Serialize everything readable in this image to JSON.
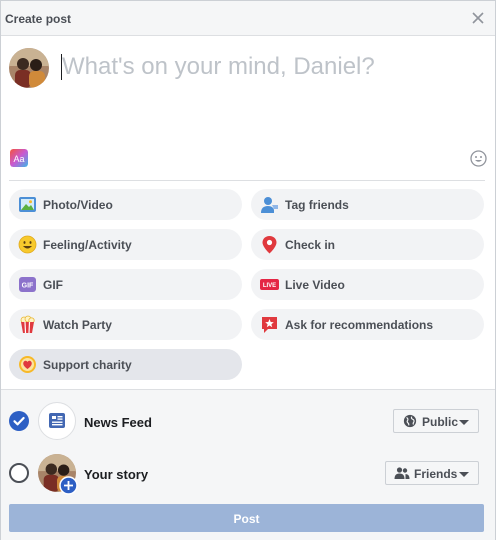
{
  "header": {
    "title": "Create post"
  },
  "composer": {
    "placeholder": "What's on your mind, Daniel?"
  },
  "actions": {
    "photo_video": "Photo/Video",
    "tag_friends": "Tag friends",
    "feeling_activity": "Feeling/Activity",
    "check_in": "Check in",
    "gif": "GIF",
    "live_video": "Live Video",
    "watch_party": "Watch Party",
    "ask_recommendations": "Ask for recommendations",
    "support_charity": "Support charity"
  },
  "icon_text": {
    "gif": "GIF",
    "live": "LIVE"
  },
  "destinations": {
    "news_feed": {
      "label": "News Feed",
      "checked": true,
      "privacy": "Public"
    },
    "your_story": {
      "label": "Your story",
      "checked": false,
      "privacy": "Friends"
    }
  },
  "post_button": {
    "label": "Post"
  },
  "colors": {
    "primary": "#2d5fc4",
    "post_disabled": "#9cb4d8",
    "pill_bg": "#f2f3f5"
  }
}
